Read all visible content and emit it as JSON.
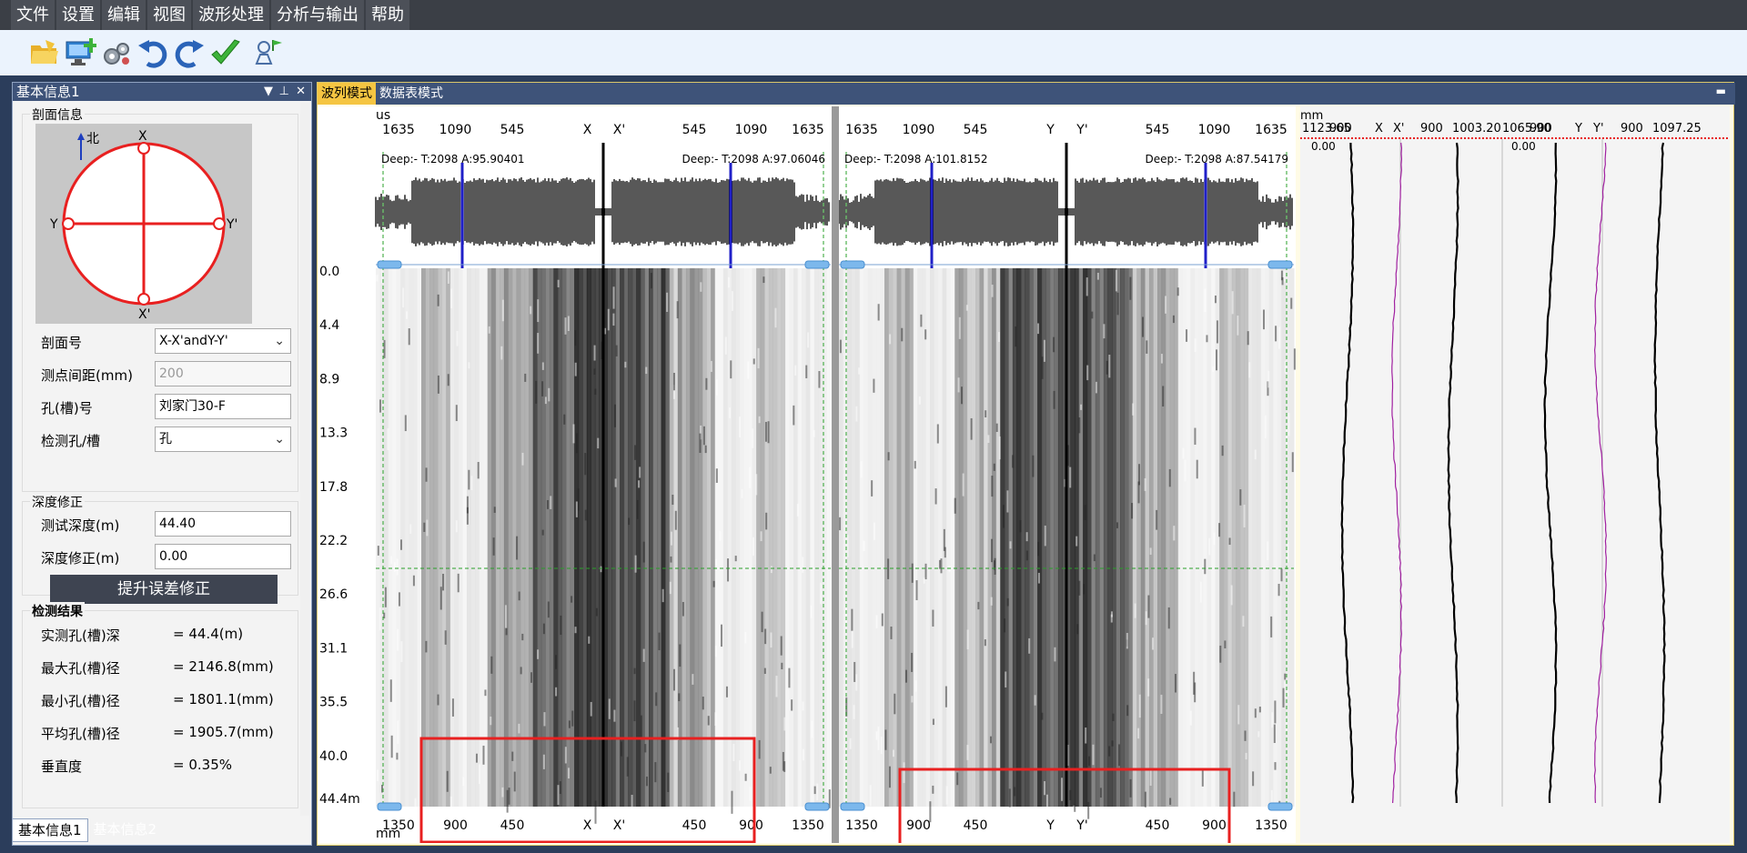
{
  "menu": [
    "文件",
    "设置",
    "编辑",
    "视图",
    "波形处理",
    "分析与输出",
    "帮助"
  ],
  "toolbar": [
    {
      "name": "open-folder-icon",
      "color": "#f2c33a"
    },
    {
      "name": "monitor-add-icon",
      "color": "#2f7fcf"
    },
    {
      "name": "gears-icon",
      "color": "#9aa3ad"
    },
    {
      "name": "undo-icon",
      "color": "#2a63b8"
    },
    {
      "name": "redo-icon",
      "color": "#2a63b8"
    },
    {
      "name": "check-icon",
      "color": "#3db33a"
    },
    {
      "name": "flag-person-icon",
      "color": "#4a6fa5"
    }
  ],
  "left_panel": {
    "title": "基本信息1",
    "profile_group": "剖面信息",
    "north_label": "北",
    "compass": {
      "top": "X",
      "bottom": "X'",
      "left": "Y",
      "right": "Y'"
    },
    "fields": [
      {
        "label": "剖面号",
        "value": "X-X'andY-Y'",
        "type": "dropdown"
      },
      {
        "label": "测点间距(mm)",
        "value": "200",
        "type": "disabled"
      },
      {
        "label": "孔(槽)号",
        "value": "刘家门30-F",
        "type": "text"
      },
      {
        "label": "检测孔/槽",
        "value": "孔",
        "type": "dropdown"
      }
    ],
    "depth_group": "深度修正",
    "depth_fields": [
      {
        "label": "测试深度(m)",
        "value": "44.40"
      },
      {
        "label": "深度修正(m)",
        "value": "0.00"
      }
    ],
    "fix_button": "提升误差修正",
    "results_group": "检测结果",
    "results": [
      {
        "label": "实测孔(槽)深",
        "value": "= 44.4(m)"
      },
      {
        "label": "最大孔(槽)径",
        "value": "= 2146.8(mm)"
      },
      {
        "label": "最小孔(槽)径",
        "value": "= 1801.1(mm)"
      },
      {
        "label": "平均孔(槽)径",
        "value": "= 1905.7(mm)"
      },
      {
        "label": "垂直度",
        "value": "= 0.35%"
      }
    ]
  },
  "bottom_tabs": [
    "基本信息1",
    "基本信息2"
  ],
  "main_tabs": [
    "波列模式",
    "数据表模式"
  ],
  "wave": {
    "top_unit": "us",
    "bottom_unit": "mm",
    "top_ticks_left": [
      "1635",
      "1090",
      "545",
      "X",
      "X'",
      "545",
      "1090",
      "1635"
    ],
    "top_ticks_right": [
      "1635",
      "1090",
      "545",
      "Y",
      "Y'",
      "545",
      "1090",
      "1635"
    ],
    "bottom_ticks_left": [
      "1350",
      "900",
      "450",
      "X",
      "X'",
      "450",
      "900",
      "1350"
    ],
    "bottom_ticks_right": [
      "1350",
      "900",
      "450",
      "Y",
      "Y'",
      "450",
      "900",
      "1350"
    ],
    "readouts": [
      "Deep:- T:2098 A:95.90401",
      "Deep:- T:2098 A:97.06046",
      "Deep:- T:2098 A:101.8152",
      "Deep:- T:2098 A:87.54179"
    ],
    "depth_ticks": [
      "0.0",
      "4.4",
      "8.9",
      "13.3",
      "17.8",
      "22.2",
      "26.6",
      "31.1",
      "35.5",
      "40.0",
      "44.4m"
    ],
    "highlight_color": "#e82020"
  },
  "depth_chart": {
    "unit": "mm",
    "header_left": [
      "1123.65",
      "900",
      "X",
      "X'",
      "900",
      "1003.20"
    ],
    "header_right": [
      "1065.90",
      "900",
      "Y",
      "Y'",
      "900",
      "1097.25"
    ],
    "zero_labels": [
      "0.00",
      "0.00"
    ]
  }
}
